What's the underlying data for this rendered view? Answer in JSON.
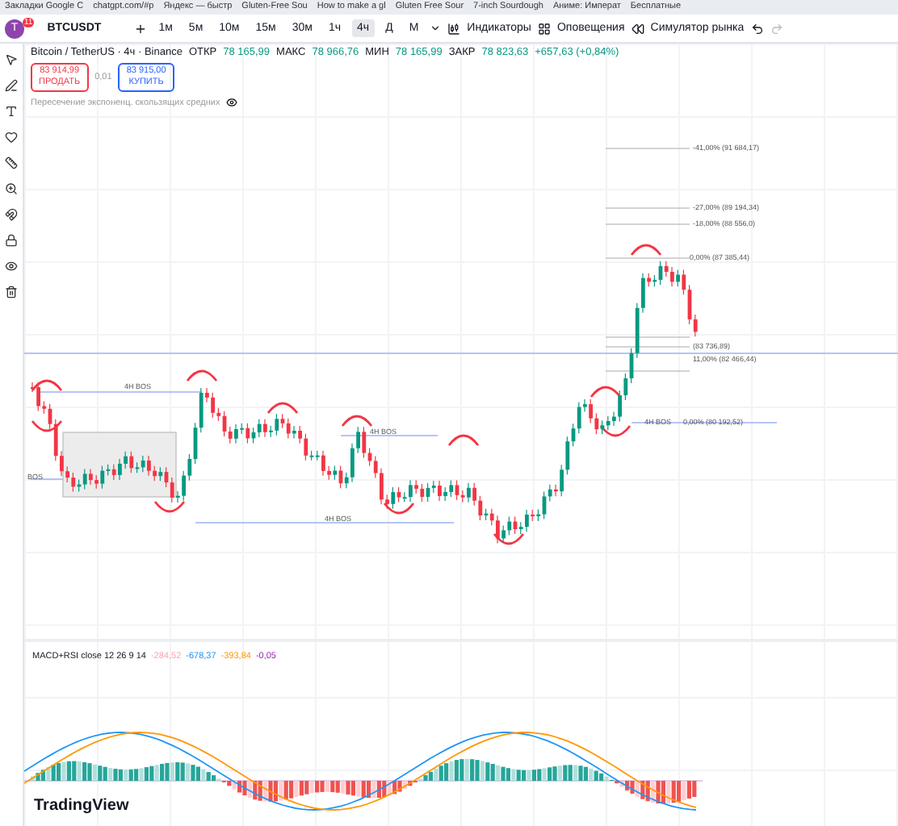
{
  "bookmarks": [
    "Закладки Google C",
    "chatgpt.com/#p",
    "Яндекс — быстр",
    "Gluten-Free Sou",
    "How to make a gl",
    "Gluten Free Sour",
    "7-inch Sourdough",
    "Аниме: Императ",
    "Бесплатные"
  ],
  "toolbar": {
    "avatar": "T",
    "badge": "11",
    "symbol": "BTCUSDT",
    "intervals": [
      {
        "label": "1м",
        "selected": false
      },
      {
        "label": "5м",
        "selected": false
      },
      {
        "label": "10м",
        "selected": false
      },
      {
        "label": "15м",
        "selected": false
      },
      {
        "label": "30м",
        "selected": false
      },
      {
        "label": "1ч",
        "selected": false
      },
      {
        "label": "4ч",
        "selected": true
      },
      {
        "label": "Д",
        "selected": false
      },
      {
        "label": "М",
        "selected": false
      }
    ],
    "indicators": "Индикаторы",
    "alerts": "Оповещения",
    "simulator": "Симулятор рынка"
  },
  "legend": {
    "title": "Bitcoin / TetherUS · 4ч · Binance",
    "ohlc": [
      {
        "label": "ОТКР",
        "value": "78 165,99"
      },
      {
        "label": "МАКС",
        "value": "78 966,76"
      },
      {
        "label": "МИН",
        "value": "78 165,99"
      },
      {
        "label": "ЗАКР",
        "value": "78 823,63"
      }
    ],
    "change": "+657,63 (+0,84%)",
    "sell_price": "83 914,99",
    "sell": "ПРОДАТЬ",
    "spread": "0,01",
    "buy_price": "83 915,00",
    "buy": "КУПИТЬ",
    "indicator": "Пересечение экспоненц. скользящих средних"
  },
  "annotations": [
    {
      "text": "4H BOS"
    },
    {
      "text": "BOS"
    },
    {
      "text": "4H BOS"
    },
    {
      "text": "4H BOS"
    },
    {
      "text": "4H BOS"
    }
  ],
  "fib_levels": [
    "-41,00% (91 684,17)",
    "-27,00% (89 194,34)",
    "-18,00% (88 556,0)",
    "0,00% (87 385,44)",
    "(83 736,89)",
    "11,00% (82 466,44)",
    "0,00% (80 192,52)"
  ],
  "macd": {
    "legend": "MACD+RSI close 12 26 9 14",
    "values": [
      {
        "text": "-284,52",
        "color": "#f7a8b0"
      },
      {
        "text": "-678,37",
        "color": "#2196f3"
      },
      {
        "text": "-393,84",
        "color": "#ff9800"
      },
      {
        "text": "-0,05",
        "color": "#9c27b0"
      }
    ]
  },
  "logo": "TradingView"
}
